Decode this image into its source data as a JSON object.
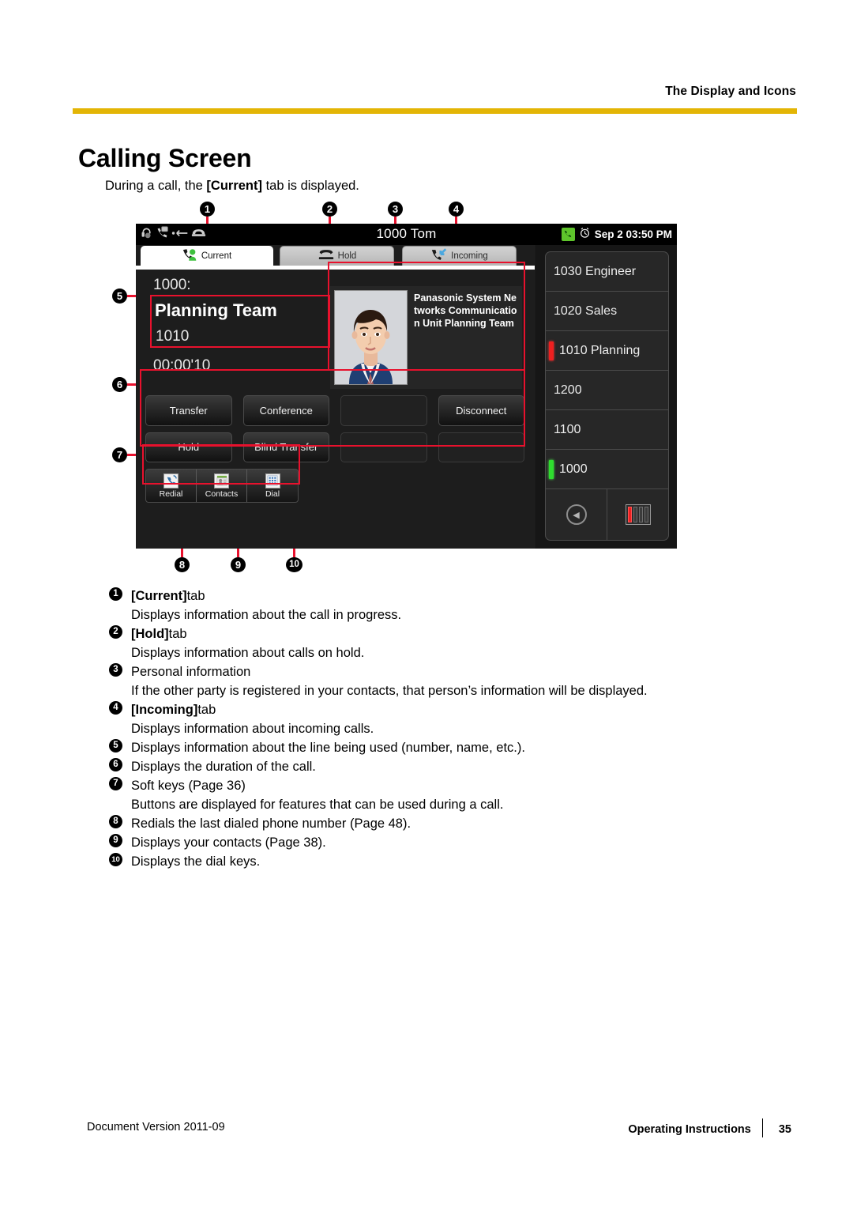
{
  "header": {
    "running_head": "The Display and Icons",
    "rule_color": "#e3b505"
  },
  "page": {
    "title": "Calling Screen",
    "intro_prefix": "During a call, the ",
    "intro_bold": "[Current]",
    "intro_suffix": " tab is displayed."
  },
  "phone": {
    "statusbar": {
      "icons_left": [
        "headset-muted-icon",
        "handset-message-icon",
        "arrow-left-icon",
        "phone-cradle-icon"
      ],
      "center_number": "1000",
      "center_name": "Tom",
      "call-icon": "green-handset-icon",
      "alarm-icon": "alarm-clock-icon",
      "datetime": "Sep 2 03:50 PM"
    },
    "tabs": [
      {
        "label": "Current",
        "icon": "contact-handset-icon",
        "active": true
      },
      {
        "label": "Hold",
        "icon": "hold-handset-icon",
        "active": false
      },
      {
        "label": "Incoming",
        "icon": "incoming-call-icon",
        "active": false
      }
    ],
    "call": {
      "line_label": "1000:",
      "party_name": "Planning Team",
      "party_number": "1010",
      "duration": "00:00'10"
    },
    "personal": {
      "avatar": "person-photo",
      "text": "Panasonic System Networks Communication Unit Planning Team"
    },
    "softkeys": [
      {
        "label": "Transfer",
        "empty": false
      },
      {
        "label": "Conference",
        "empty": false
      },
      {
        "label": "",
        "empty": true
      },
      {
        "label": "Disconnect",
        "empty": false
      },
      {
        "label": "Hold",
        "empty": false
      },
      {
        "label": "Blind Transfer",
        "empty": false
      },
      {
        "label": "",
        "empty": true
      },
      {
        "label": "",
        "empty": true
      }
    ],
    "iconbar": [
      {
        "label": "Redial",
        "icon": "redial-icon"
      },
      {
        "label": "Contacts",
        "icon": "contacts-icon"
      },
      {
        "label": "Dial",
        "icon": "dial-keypad-icon"
      }
    ],
    "dss": {
      "rows": [
        {
          "label": "1030 Engineer",
          "led": "none"
        },
        {
          "label": "1020 Sales",
          "led": "none"
        },
        {
          "label": "1010 Planning",
          "led": "red"
        },
        {
          "label": "1200",
          "led": "none"
        },
        {
          "label": "1100",
          "led": "none"
        },
        {
          "label": "1000",
          "led": "green"
        }
      ],
      "page_back_icon": "page-back-icon",
      "page_indicator_icon": "page-indicator-icon"
    },
    "callout_numbers": [
      "1",
      "2",
      "3",
      "4",
      "5",
      "6",
      "7",
      "8",
      "9",
      "10"
    ],
    "annotation_color": "#e8112d"
  },
  "legend": [
    {
      "num": "1",
      "bold": "[Current]",
      "rest": " tab",
      "sub": "Displays information about the call in progress."
    },
    {
      "num": "2",
      "bold": "[Hold]",
      "rest": " tab",
      "sub": "Displays information about calls on hold."
    },
    {
      "num": "3",
      "bold": "",
      "rest": "Personal information",
      "sub": "If the other party is registered in your contacts, that person’s information will be displayed."
    },
    {
      "num": "4",
      "bold": "[Incoming]",
      "rest": " tab",
      "sub": "Displays information about incoming calls."
    },
    {
      "num": "5",
      "bold": "",
      "rest": "Displays information about the line being used (number, name, etc.).",
      "sub": ""
    },
    {
      "num": "6",
      "bold": "",
      "rest": "Displays the duration of the call.",
      "sub": ""
    },
    {
      "num": "7",
      "bold": "",
      "rest": "Soft keys (Page 36)",
      "sub": "Buttons are displayed for features that can be used during a call."
    },
    {
      "num": "8",
      "bold": "",
      "rest": "Redials the last dialed phone number (Page 48).",
      "sub": ""
    },
    {
      "num": "9",
      "bold": "",
      "rest": "Displays your contacts (Page 38).",
      "sub": ""
    },
    {
      "num": "10",
      "bold": "",
      "rest": "Displays the dial keys.",
      "sub": ""
    }
  ],
  "footer": {
    "document_version": "Document Version  2011-09",
    "manual_name": "Operating Instructions",
    "page_number": "35"
  }
}
